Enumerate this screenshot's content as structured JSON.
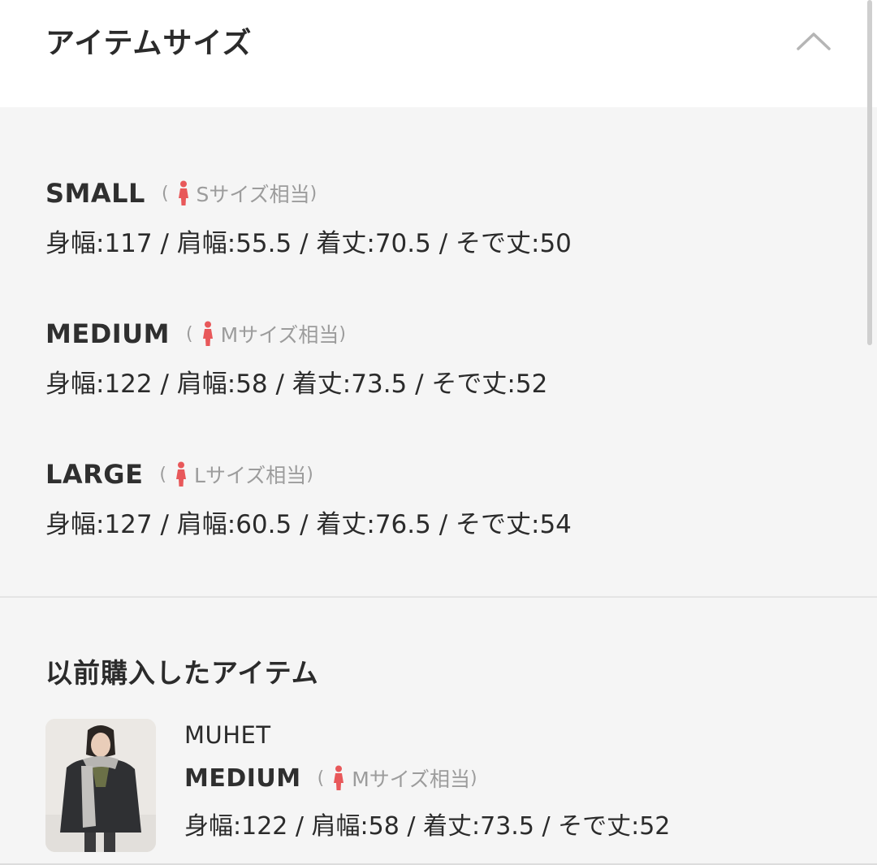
{
  "header": {
    "title": "アイテムサイズ",
    "collapse_icon": "chevron-up-icon"
  },
  "sizes": [
    {
      "name": "SMALL",
      "equiv": {
        "open": "(",
        "label": "Sサイズ相当",
        "close": ")"
      },
      "measure": "身幅:117 / 肩幅:55.5 / 着丈:70.5 / そで丈:50"
    },
    {
      "name": "MEDIUM",
      "equiv": {
        "open": "(",
        "label": "Mサイズ相当",
        "close": ")"
      },
      "measure": "身幅:122 / 肩幅:58 / 着丈:73.5 / そで丈:52"
    },
    {
      "name": "LARGE",
      "equiv": {
        "open": "(",
        "label": "Lサイズ相当",
        "close": ")"
      },
      "measure": "身幅:127 / 肩幅:60.5 / 着丈:76.5 / そで丈:54"
    }
  ],
  "previous": {
    "title": "以前購入したアイテム",
    "item": {
      "brand": "MUHET",
      "size_name": "MEDIUM",
      "equiv": {
        "open": "(",
        "label": "Mサイズ相当",
        "close": ")"
      },
      "measure": "身幅:122 / 肩幅:58 / 着丈:73.5 / そで丈:52"
    }
  },
  "colors": {
    "accent_person_icon": "#e8585a",
    "background": "#f5f5f5",
    "header_background": "#ffffff"
  },
  "icons": {
    "person": "woman-figure-icon"
  }
}
